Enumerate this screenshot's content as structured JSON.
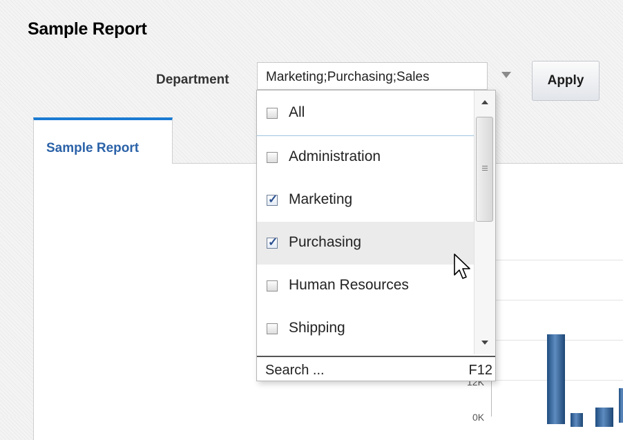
{
  "page": {
    "title": "Sample Report"
  },
  "parameter": {
    "label": "Department",
    "value": "Marketing;Purchasing;Sales",
    "apply_label": "Apply"
  },
  "tabs": [
    {
      "label": "Sample Report",
      "active": true
    }
  ],
  "dropdown": {
    "all_label": "All",
    "options": [
      {
        "label": "Administration",
        "checked": false
      },
      {
        "label": "Marketing",
        "checked": true
      },
      {
        "label": "Purchasing",
        "checked": true,
        "hovered": true
      },
      {
        "label": "Human Resources",
        "checked": false
      },
      {
        "label": "Shipping",
        "checked": false
      }
    ],
    "search_label": "Search ...",
    "search_shortcut": "F12"
  },
  "chart_partial": {
    "ytick_visible": "12K",
    "ytick_partial": "0K"
  },
  "colors": {
    "tab_accent": "#1a7bd2",
    "tab_text": "#2b62a8",
    "bar": "#1f4d80",
    "hover_row": "#ebebeb"
  },
  "icons": {
    "dropdown_arrow": "triangle-down",
    "checkbox_checked": "check",
    "cursor": "arrow-pointer"
  }
}
